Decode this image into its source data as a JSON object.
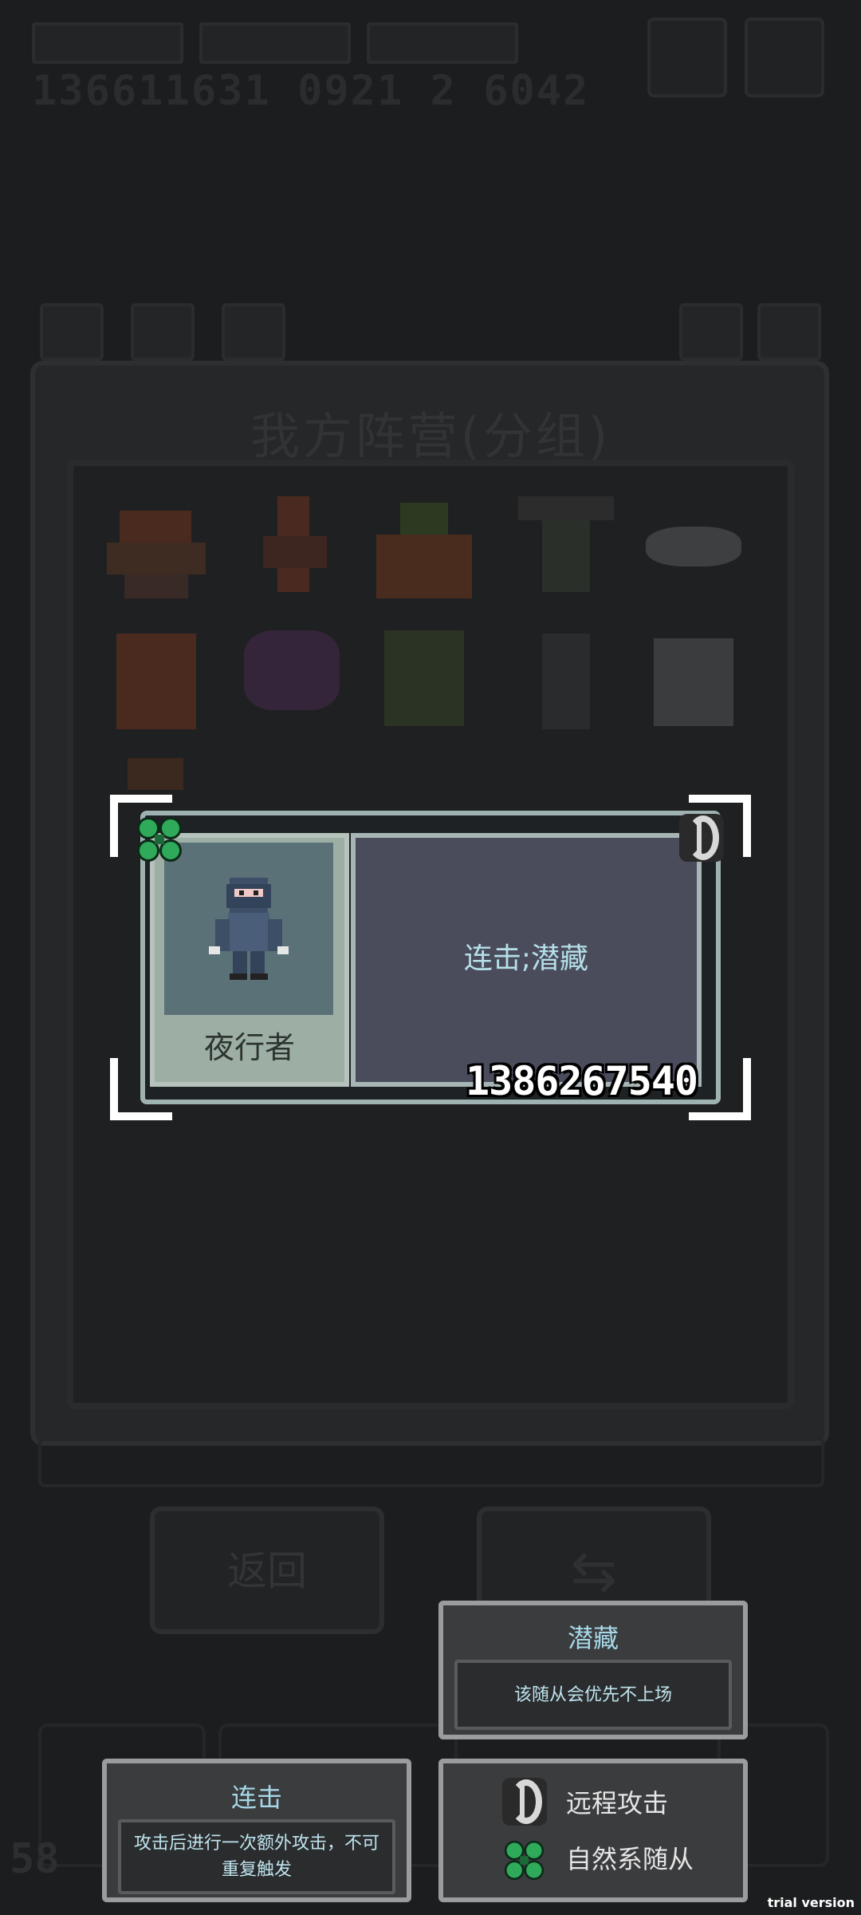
{
  "background": {
    "top_number": "136611631 0921 2 6042",
    "panel_title": "我方阵营(分组)",
    "back_button": "返回",
    "swap_icon": "swap-icon",
    "corner_value": "58"
  },
  "card": {
    "unit_name": "夜行者",
    "skills": "连击;潜藏",
    "id": "1386267540",
    "element_icon": "clover-icon",
    "attack_icon": "bow-icon"
  },
  "tooltip_stealth": {
    "title": "潜藏",
    "body": "该随从会优先不上场"
  },
  "tooltip_combo": {
    "title": "连击",
    "body": "攻击后进行一次额外攻击，不可重复触发"
  },
  "tooltip_tags": {
    "ranged": "远程攻击",
    "nature": "自然系随从"
  },
  "watermark": "trial version",
  "colors": {
    "skill_text": "#b5dfe8",
    "card_border": "#9fb2b2",
    "clover": "#2faa5a"
  }
}
